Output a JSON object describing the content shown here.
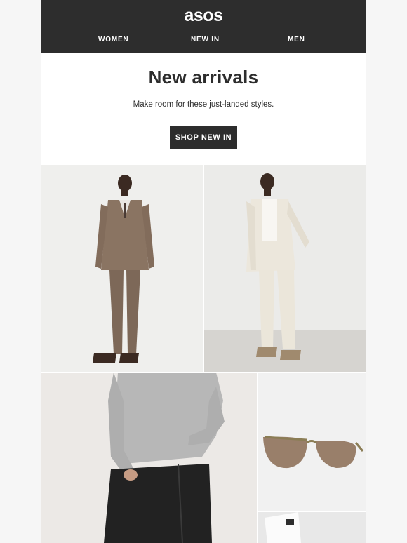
{
  "header": {
    "logo": "asos",
    "nav": [
      "WOMEN",
      "NEW IN",
      "MEN"
    ]
  },
  "hero": {
    "title": "New arrivals",
    "subtitle": "Make room for these just-landed styles.",
    "cta_label": "SHOP NEW IN"
  },
  "colors": {
    "brand_dark": "#2d2d2d",
    "page_bg": "#f6f6f6",
    "content_bg": "#ffffff"
  }
}
